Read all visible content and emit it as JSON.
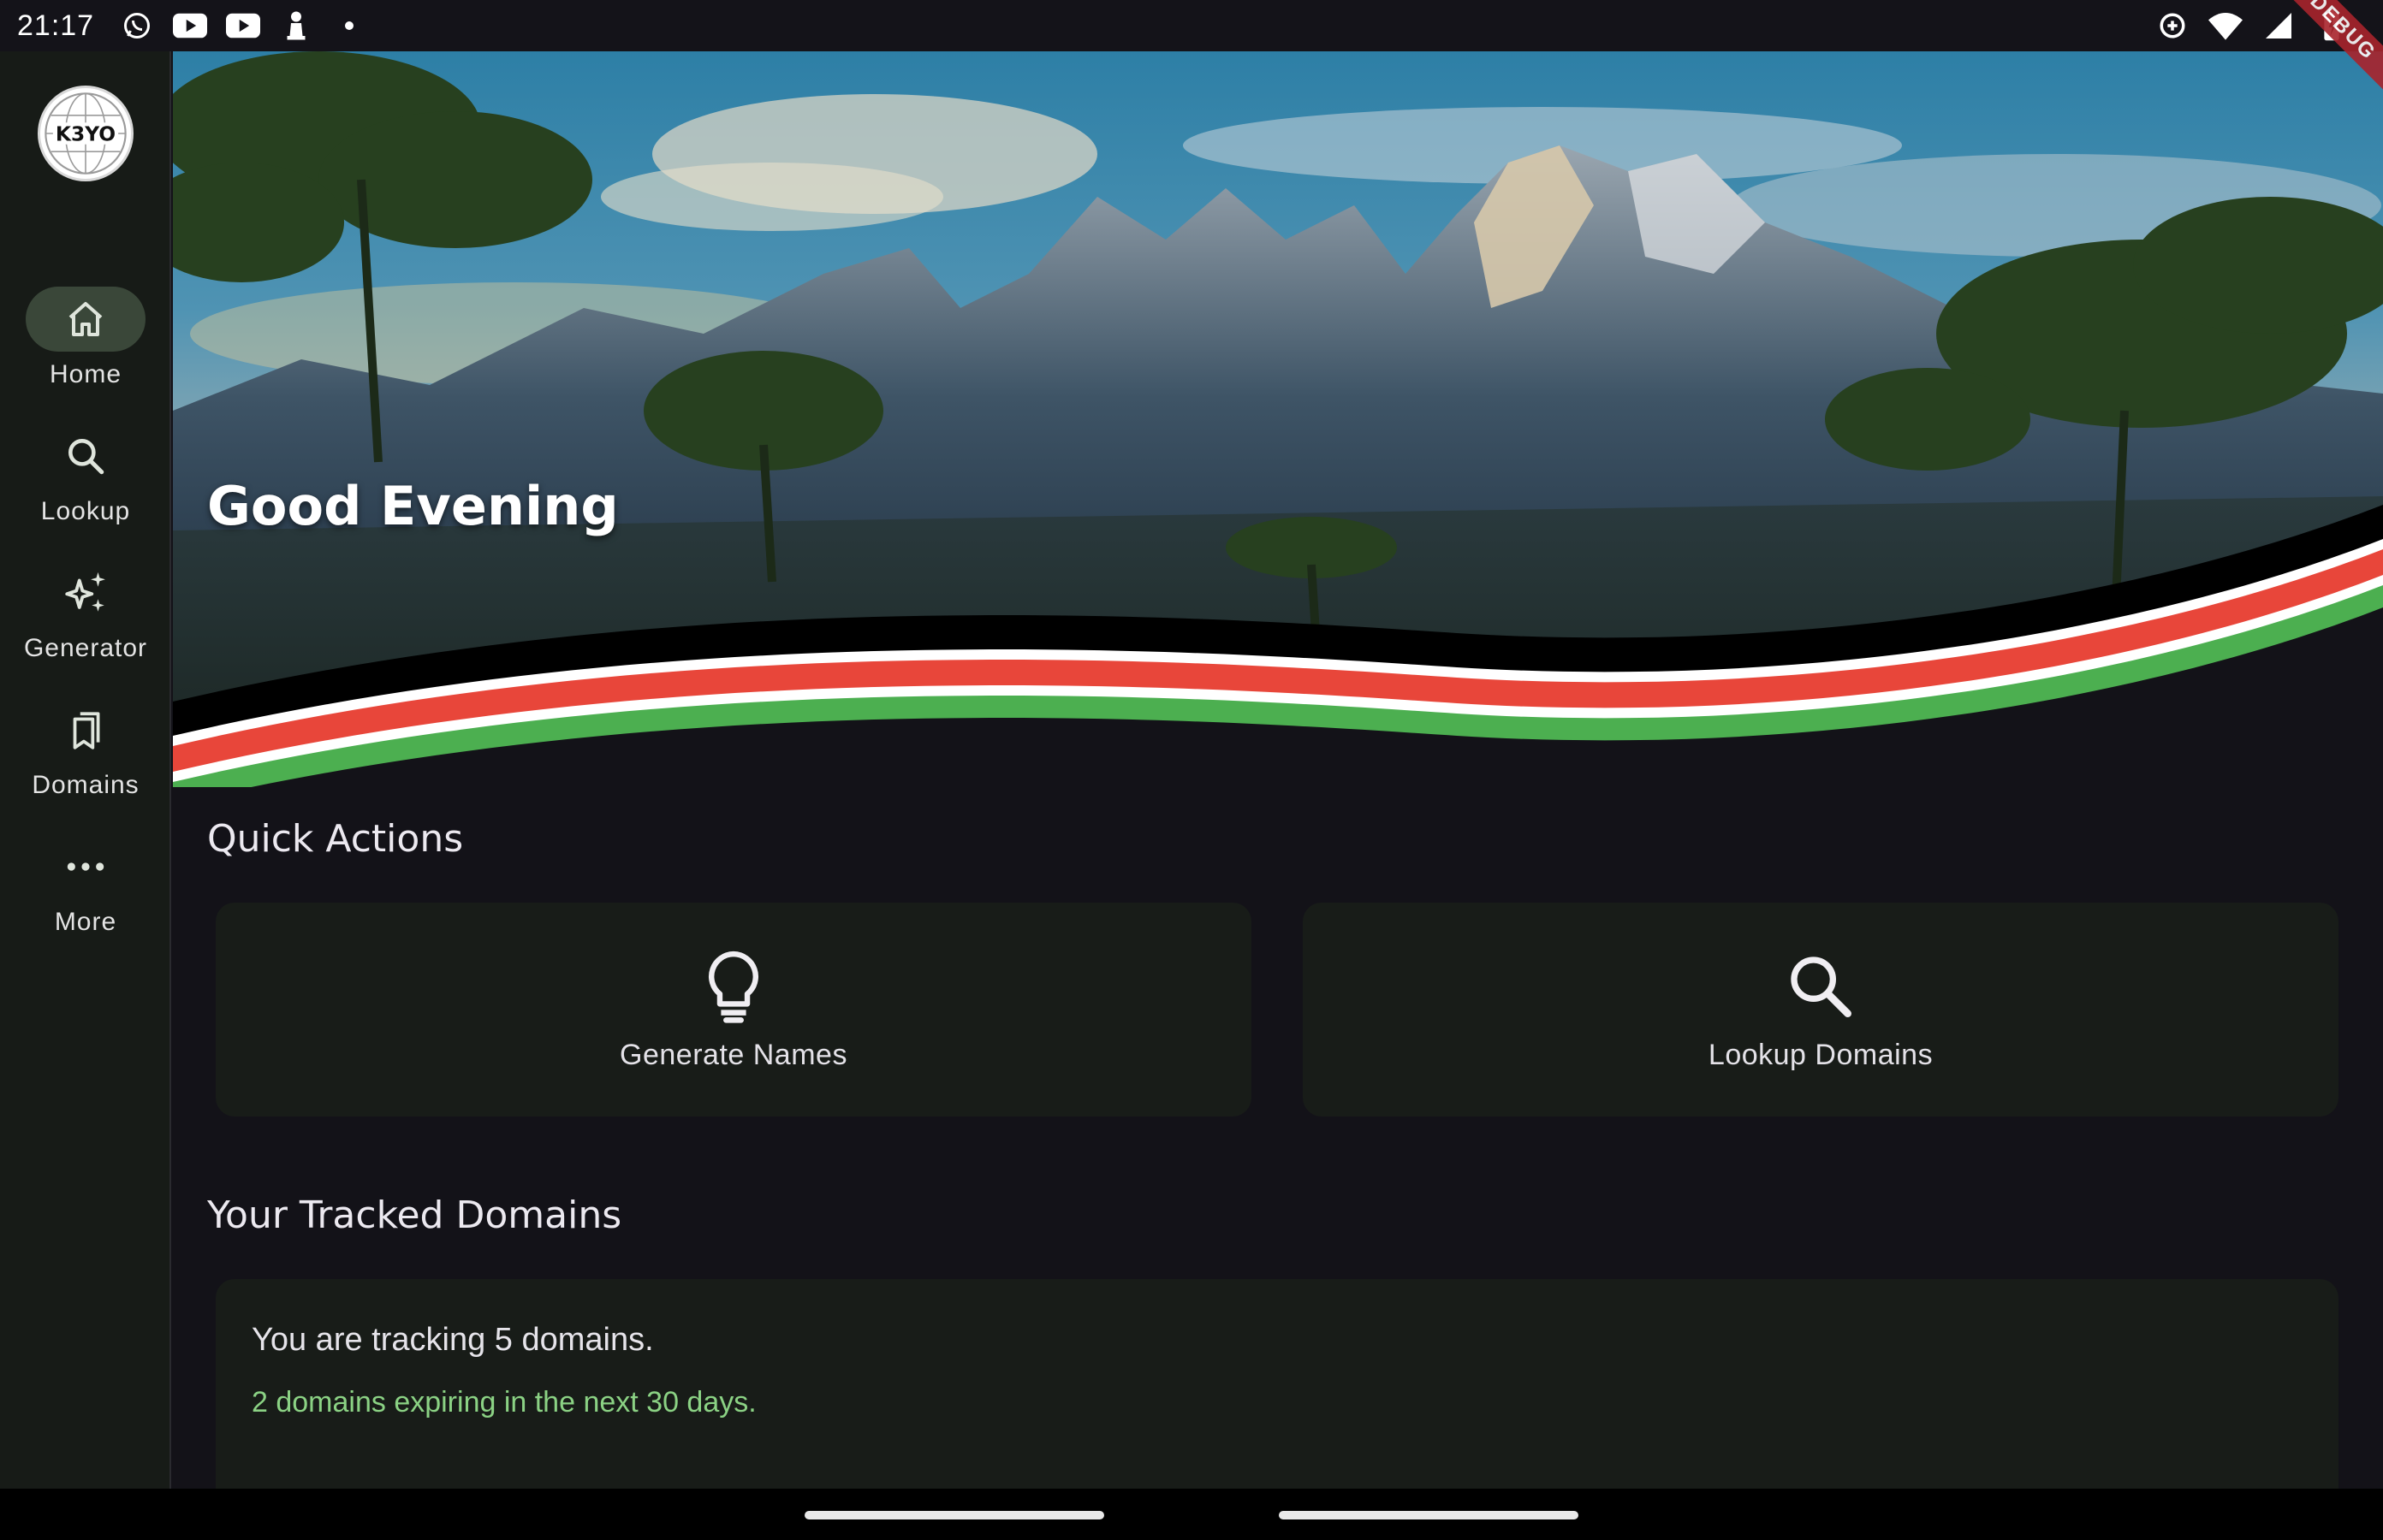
{
  "status_bar": {
    "time": "21:17",
    "left_icons": [
      "whatsapp-icon",
      "youtube-icon",
      "youtube-icon",
      "chess-pawn-icon",
      "dot-icon"
    ],
    "right_icons": [
      "data-saver-icon",
      "wifi-icon",
      "signal-icon",
      "battery-charging-icon"
    ]
  },
  "debug_banner": "DEBUG",
  "logo": {
    "text": "K3YO",
    "icon": "globe-logo"
  },
  "nav": {
    "items": [
      {
        "label": "Home",
        "icon": "home-icon",
        "active": true
      },
      {
        "label": "Lookup",
        "icon": "search-icon",
        "active": false
      },
      {
        "label": "Generator",
        "icon": "sparkle-icon",
        "active": false
      },
      {
        "label": "Domains",
        "icon": "bookmarks-icon",
        "active": false
      },
      {
        "label": "More",
        "icon": "more-horizontal-icon",
        "active": false
      }
    ]
  },
  "hero": {
    "greeting": "Good Evening",
    "image": "savanna-mountains-photo",
    "stripe_colors": [
      "#000000",
      "#ffffff",
      "#e8463a",
      "#ffffff",
      "#4caf50"
    ]
  },
  "quick_actions": {
    "title": "Quick Actions",
    "items": [
      {
        "label": "Generate Names",
        "icon": "lightbulb-icon"
      },
      {
        "label": "Lookup Domains",
        "icon": "search-icon"
      }
    ]
  },
  "tracked": {
    "title": "Your Tracked Domains",
    "summary": "You are tracking 5 domains.",
    "expiring": "2 domains expiring in the next 30 days."
  },
  "colors": {
    "background": "#131218",
    "rail": "#171b17",
    "card": "#181c18",
    "active_pill": "#3a4739",
    "accent_green": "#8bd284"
  }
}
